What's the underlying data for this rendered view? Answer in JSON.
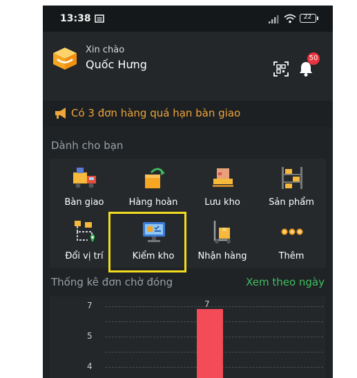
{
  "status_bar": {
    "time": "13:38",
    "battery": "22"
  },
  "header": {
    "greeting": "Xin chào",
    "user_name": "Quốc Hưng",
    "notification_count": "50"
  },
  "alert": {
    "text": "Có 3 đơn hàng quá hạn bàn giao"
  },
  "section": {
    "title": "Dành cho bạn"
  },
  "tiles": [
    {
      "label": "Bàn giao",
      "icon": "truck-icon"
    },
    {
      "label": "Hàng hoàn",
      "icon": "return-box-icon"
    },
    {
      "label": "Lưu kho",
      "icon": "storage-pallet-icon"
    },
    {
      "label": "Sản phẩm",
      "icon": "shelf-icon"
    },
    {
      "label": "Đổi vị trí",
      "icon": "relocate-icon"
    },
    {
      "label": "Kiểm kho",
      "icon": "monitor-check-icon"
    },
    {
      "label": "Nhận hàng",
      "icon": "hand-truck-icon"
    },
    {
      "label": "Thêm",
      "icon": "more-dots-icon"
    }
  ],
  "stats": {
    "title": "Thống kê đơn chờ đóng",
    "link": "Xem theo ngày"
  },
  "chart_data": {
    "type": "bar",
    "categories": [
      ""
    ],
    "values": [
      7
    ],
    "y_ticks": [
      "7",
      "5",
      "4"
    ],
    "bar_label": "7",
    "bar_color": "#f34b57"
  }
}
